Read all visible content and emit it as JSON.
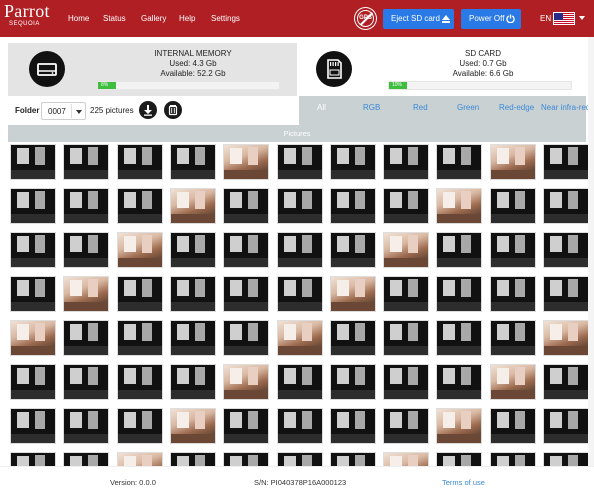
{
  "brand": {
    "name": "Parrot",
    "product": "SEQUOIA"
  },
  "nav": {
    "home": "Home",
    "status": "Status",
    "gallery": "Gallery",
    "help": "Help",
    "settings": "Settings"
  },
  "header": {
    "gps_icon_label": "GPS",
    "eject_label": "Eject SD card",
    "power_label": "Power Off",
    "language": "EN"
  },
  "internal_memory": {
    "title": "INTERNAL MEMORY",
    "used": "Used: 4.3 Gb",
    "available": "Available: 52.2 Gb",
    "percent_label": "8%",
    "percent_value": 8
  },
  "sd_card": {
    "title": "SD CARD",
    "used": "Used: 0.7 Gb",
    "available": "Available: 6.6 Gb",
    "percent_label": "10%",
    "percent_value": 10
  },
  "toolbar": {
    "folder_label": "Folder",
    "folder_value": "0007",
    "picture_count": "225 pictures"
  },
  "filters": [
    {
      "label": "All",
      "active": true
    },
    {
      "label": "RGB",
      "active": false
    },
    {
      "label": "Red",
      "active": false
    },
    {
      "label": "Green",
      "active": false
    },
    {
      "label": "Red-edge",
      "active": false
    },
    {
      "label": "Near infra-red",
      "active": false
    }
  ],
  "gallery": {
    "section_title": "Pictures",
    "rows": [
      [
        "gray",
        "gray",
        "gray",
        "gray",
        "colour",
        "gray",
        "gray",
        "gray",
        "gray",
        "colour",
        "gray"
      ],
      [
        "gray",
        "gray",
        "gray",
        "colour",
        "gray",
        "gray",
        "gray",
        "gray",
        "colour",
        "gray",
        "gray"
      ],
      [
        "gray",
        "gray",
        "colour",
        "gray",
        "gray",
        "gray",
        "gray",
        "colour",
        "gray",
        "gray",
        "gray"
      ],
      [
        "gray",
        "colour",
        "gray",
        "gray",
        "gray",
        "gray",
        "colour",
        "gray",
        "gray",
        "gray",
        "gray"
      ],
      [
        "colour",
        "gray",
        "gray",
        "gray",
        "gray",
        "colour",
        "gray",
        "gray",
        "gray",
        "gray",
        "colour"
      ],
      [
        "gray",
        "gray",
        "gray",
        "gray",
        "colour",
        "gray",
        "gray",
        "gray",
        "gray",
        "colour",
        "gray"
      ],
      [
        "gray",
        "gray",
        "gray",
        "colour",
        "gray",
        "gray",
        "gray",
        "gray",
        "colour",
        "gray",
        "gray"
      ],
      [
        "gray",
        "gray",
        "colour",
        "gray",
        "gray",
        "gray",
        "gray",
        "colour",
        "gray",
        "gray",
        "gray"
      ]
    ]
  },
  "footer": {
    "version": "Version: 0.0.0",
    "serial": "S/N: PI040378P16A000123",
    "terms": "Terms of use"
  },
  "colors": {
    "brand_red": "#b01f24",
    "button_blue": "#2979e6",
    "progress_green": "#3ebd3e",
    "filter_gray": "#c9d1d3",
    "link_blue": "#3b8ad9"
  }
}
